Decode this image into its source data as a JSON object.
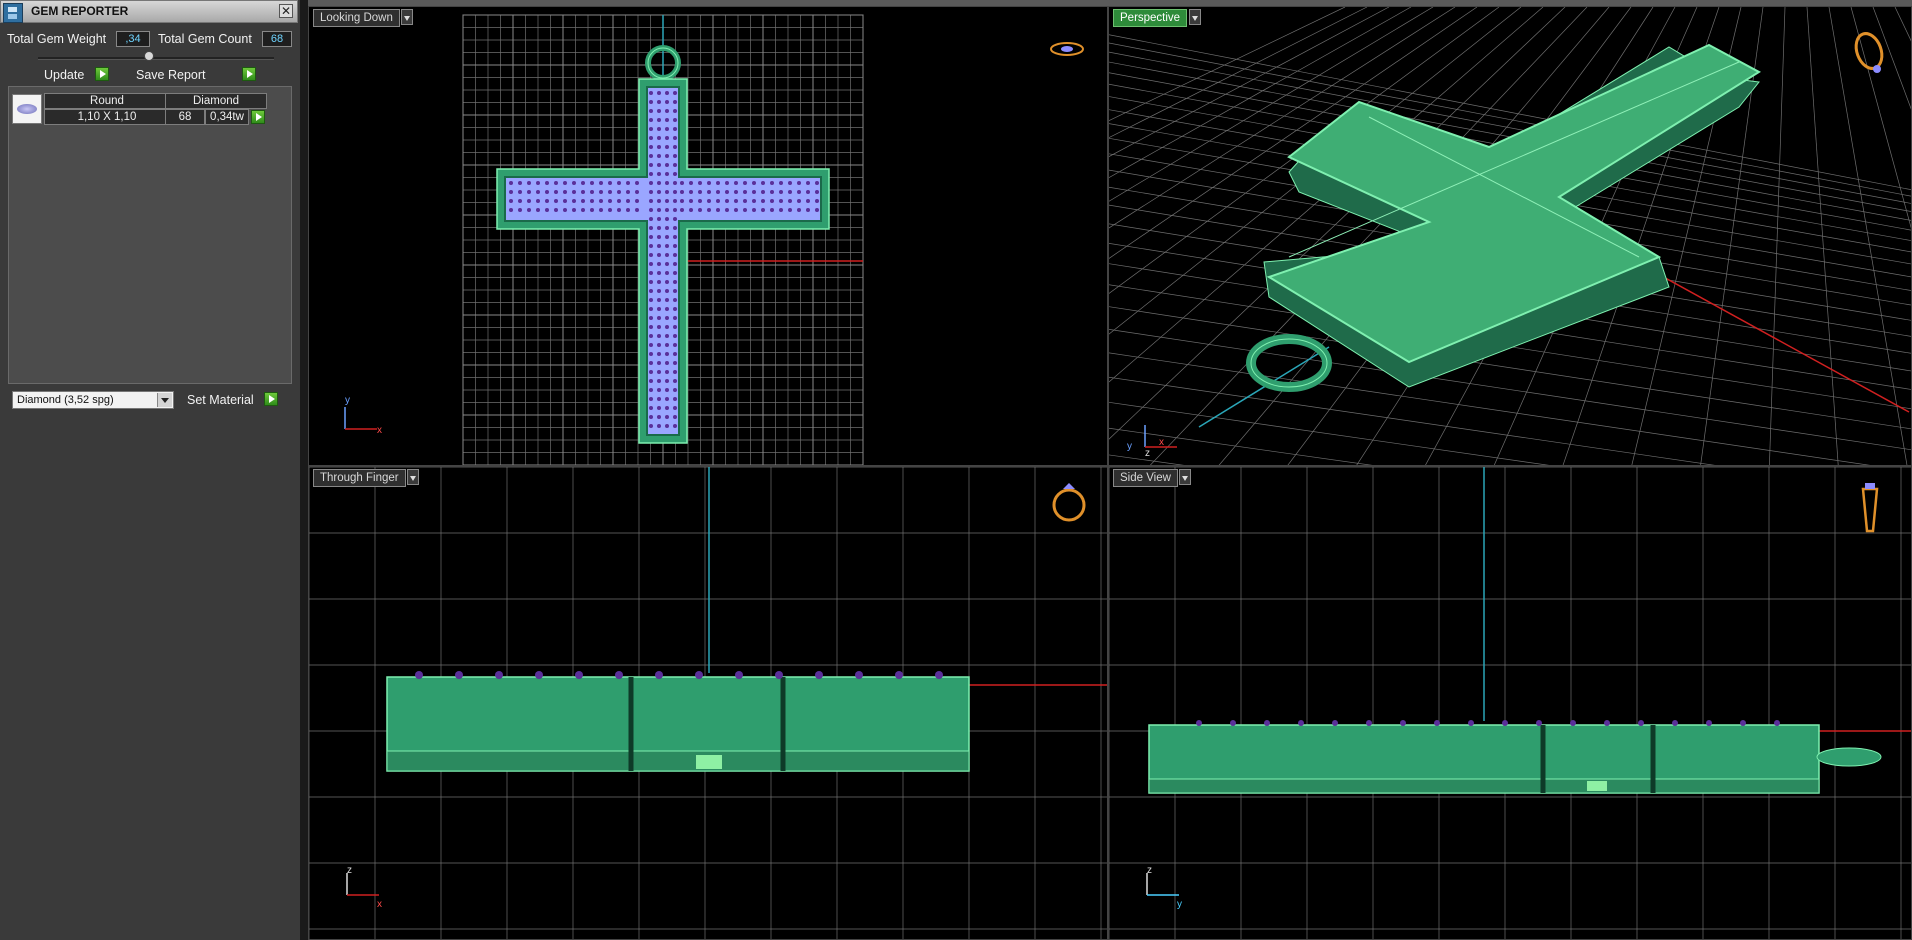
{
  "panel": {
    "title": "GEM REPORTER",
    "close_glyph": "✕",
    "total_weight_label": "Total Gem Weight",
    "total_weight_value": ",34",
    "total_count_label": "Total Gem Count",
    "total_count_value": "68",
    "update_label": "Update",
    "save_report_label": "Save Report",
    "table": {
      "headers": [
        "Round",
        "Diamond"
      ],
      "row": {
        "size": "1,10 X 1,10",
        "count": "68",
        "weight": "0,34tw"
      }
    },
    "material_select": "Diamond     (3,52 spg)",
    "set_material_label": "Set Material"
  },
  "viewports": {
    "top": {
      "label": "Looking Down",
      "axis_v": "y",
      "axis_h": "x"
    },
    "persp": {
      "label": "Perspective",
      "axis_a": "y",
      "axis_b": "z",
      "axis_c": "x"
    },
    "front": {
      "label": "Through Finger",
      "axis_v": "z",
      "axis_h": "x"
    },
    "side": {
      "label": "Side View",
      "axis_v": "z",
      "axis_h": "y"
    }
  },
  "colors": {
    "metal": "#2f9e6e",
    "metal_edge": "#7ff0b0",
    "gem": "#9aa6ff",
    "prong": "#5a2f9a",
    "grid": "#6f6f6f",
    "axis_red": "#d02020",
    "axis_cyan": "#2aa6b8"
  },
  "icons": [
    "gem-reporter-logo-icon",
    "close-icon",
    "round-gem-icon",
    "ring-orientation-icon"
  ]
}
